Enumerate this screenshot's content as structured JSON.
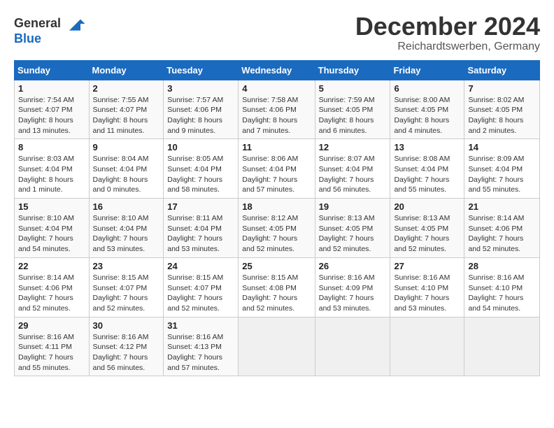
{
  "logo": {
    "line1": "General",
    "line2": "Blue"
  },
  "title": "December 2024",
  "location": "Reichardtswerben, Germany",
  "weekdays": [
    "Sunday",
    "Monday",
    "Tuesday",
    "Wednesday",
    "Thursday",
    "Friday",
    "Saturday"
  ],
  "weeks": [
    [
      {
        "day": "1",
        "sunrise": "Sunrise: 7:54 AM",
        "sunset": "Sunset: 4:07 PM",
        "daylight": "Daylight: 8 hours and 13 minutes."
      },
      {
        "day": "2",
        "sunrise": "Sunrise: 7:55 AM",
        "sunset": "Sunset: 4:07 PM",
        "daylight": "Daylight: 8 hours and 11 minutes."
      },
      {
        "day": "3",
        "sunrise": "Sunrise: 7:57 AM",
        "sunset": "Sunset: 4:06 PM",
        "daylight": "Daylight: 8 hours and 9 minutes."
      },
      {
        "day": "4",
        "sunrise": "Sunrise: 7:58 AM",
        "sunset": "Sunset: 4:06 PM",
        "daylight": "Daylight: 8 hours and 7 minutes."
      },
      {
        "day": "5",
        "sunrise": "Sunrise: 7:59 AM",
        "sunset": "Sunset: 4:05 PM",
        "daylight": "Daylight: 8 hours and 6 minutes."
      },
      {
        "day": "6",
        "sunrise": "Sunrise: 8:00 AM",
        "sunset": "Sunset: 4:05 PM",
        "daylight": "Daylight: 8 hours and 4 minutes."
      },
      {
        "day": "7",
        "sunrise": "Sunrise: 8:02 AM",
        "sunset": "Sunset: 4:05 PM",
        "daylight": "Daylight: 8 hours and 2 minutes."
      }
    ],
    [
      {
        "day": "8",
        "sunrise": "Sunrise: 8:03 AM",
        "sunset": "Sunset: 4:04 PM",
        "daylight": "Daylight: 8 hours and 1 minute."
      },
      {
        "day": "9",
        "sunrise": "Sunrise: 8:04 AM",
        "sunset": "Sunset: 4:04 PM",
        "daylight": "Daylight: 8 hours and 0 minutes."
      },
      {
        "day": "10",
        "sunrise": "Sunrise: 8:05 AM",
        "sunset": "Sunset: 4:04 PM",
        "daylight": "Daylight: 7 hours and 58 minutes."
      },
      {
        "day": "11",
        "sunrise": "Sunrise: 8:06 AM",
        "sunset": "Sunset: 4:04 PM",
        "daylight": "Daylight: 7 hours and 57 minutes."
      },
      {
        "day": "12",
        "sunrise": "Sunrise: 8:07 AM",
        "sunset": "Sunset: 4:04 PM",
        "daylight": "Daylight: 7 hours and 56 minutes."
      },
      {
        "day": "13",
        "sunrise": "Sunrise: 8:08 AM",
        "sunset": "Sunset: 4:04 PM",
        "daylight": "Daylight: 7 hours and 55 minutes."
      },
      {
        "day": "14",
        "sunrise": "Sunrise: 8:09 AM",
        "sunset": "Sunset: 4:04 PM",
        "daylight": "Daylight: 7 hours and 55 minutes."
      }
    ],
    [
      {
        "day": "15",
        "sunrise": "Sunrise: 8:10 AM",
        "sunset": "Sunset: 4:04 PM",
        "daylight": "Daylight: 7 hours and 54 minutes."
      },
      {
        "day": "16",
        "sunrise": "Sunrise: 8:10 AM",
        "sunset": "Sunset: 4:04 PM",
        "daylight": "Daylight: 7 hours and 53 minutes."
      },
      {
        "day": "17",
        "sunrise": "Sunrise: 8:11 AM",
        "sunset": "Sunset: 4:04 PM",
        "daylight": "Daylight: 7 hours and 53 minutes."
      },
      {
        "day": "18",
        "sunrise": "Sunrise: 8:12 AM",
        "sunset": "Sunset: 4:05 PM",
        "daylight": "Daylight: 7 hours and 52 minutes."
      },
      {
        "day": "19",
        "sunrise": "Sunrise: 8:13 AM",
        "sunset": "Sunset: 4:05 PM",
        "daylight": "Daylight: 7 hours and 52 minutes."
      },
      {
        "day": "20",
        "sunrise": "Sunrise: 8:13 AM",
        "sunset": "Sunset: 4:05 PM",
        "daylight": "Daylight: 7 hours and 52 minutes."
      },
      {
        "day": "21",
        "sunrise": "Sunrise: 8:14 AM",
        "sunset": "Sunset: 4:06 PM",
        "daylight": "Daylight: 7 hours and 52 minutes."
      }
    ],
    [
      {
        "day": "22",
        "sunrise": "Sunrise: 8:14 AM",
        "sunset": "Sunset: 4:06 PM",
        "daylight": "Daylight: 7 hours and 52 minutes."
      },
      {
        "day": "23",
        "sunrise": "Sunrise: 8:15 AM",
        "sunset": "Sunset: 4:07 PM",
        "daylight": "Daylight: 7 hours and 52 minutes."
      },
      {
        "day": "24",
        "sunrise": "Sunrise: 8:15 AM",
        "sunset": "Sunset: 4:07 PM",
        "daylight": "Daylight: 7 hours and 52 minutes."
      },
      {
        "day": "25",
        "sunrise": "Sunrise: 8:15 AM",
        "sunset": "Sunset: 4:08 PM",
        "daylight": "Daylight: 7 hours and 52 minutes."
      },
      {
        "day": "26",
        "sunrise": "Sunrise: 8:16 AM",
        "sunset": "Sunset: 4:09 PM",
        "daylight": "Daylight: 7 hours and 53 minutes."
      },
      {
        "day": "27",
        "sunrise": "Sunrise: 8:16 AM",
        "sunset": "Sunset: 4:10 PM",
        "daylight": "Daylight: 7 hours and 53 minutes."
      },
      {
        "day": "28",
        "sunrise": "Sunrise: 8:16 AM",
        "sunset": "Sunset: 4:10 PM",
        "daylight": "Daylight: 7 hours and 54 minutes."
      }
    ],
    [
      {
        "day": "29",
        "sunrise": "Sunrise: 8:16 AM",
        "sunset": "Sunset: 4:11 PM",
        "daylight": "Daylight: 7 hours and 55 minutes."
      },
      {
        "day": "30",
        "sunrise": "Sunrise: 8:16 AM",
        "sunset": "Sunset: 4:12 PM",
        "daylight": "Daylight: 7 hours and 56 minutes."
      },
      {
        "day": "31",
        "sunrise": "Sunrise: 8:16 AM",
        "sunset": "Sunset: 4:13 PM",
        "daylight": "Daylight: 7 hours and 57 minutes."
      },
      null,
      null,
      null,
      null
    ]
  ]
}
